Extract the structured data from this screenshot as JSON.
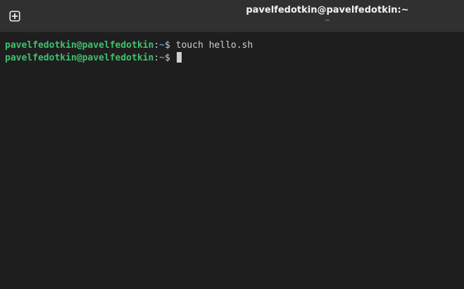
{
  "window": {
    "title": "pavelfedotkin@pavelfedotkin:~",
    "subtitle": "~"
  },
  "toolbar": {
    "new_tab_icon": "plus-square-icon"
  },
  "terminal": {
    "lines": [
      {
        "prompt_user": "pavelfedotkin@pavelfedotkin",
        "prompt_sep": ":",
        "prompt_path": "~",
        "prompt_symbol": "$ ",
        "command": "touch hello.sh"
      },
      {
        "prompt_user": "pavelfedotkin@pavelfedotkin",
        "prompt_sep": ":",
        "prompt_path": "~",
        "prompt_symbol": "$ ",
        "command": ""
      }
    ]
  },
  "colors": {
    "background": "#1e1e1e",
    "headerbar": "#303030",
    "prompt_user": "#3ec26e",
    "prompt_path": "#5a8fd8",
    "text": "#d0d0d0"
  }
}
